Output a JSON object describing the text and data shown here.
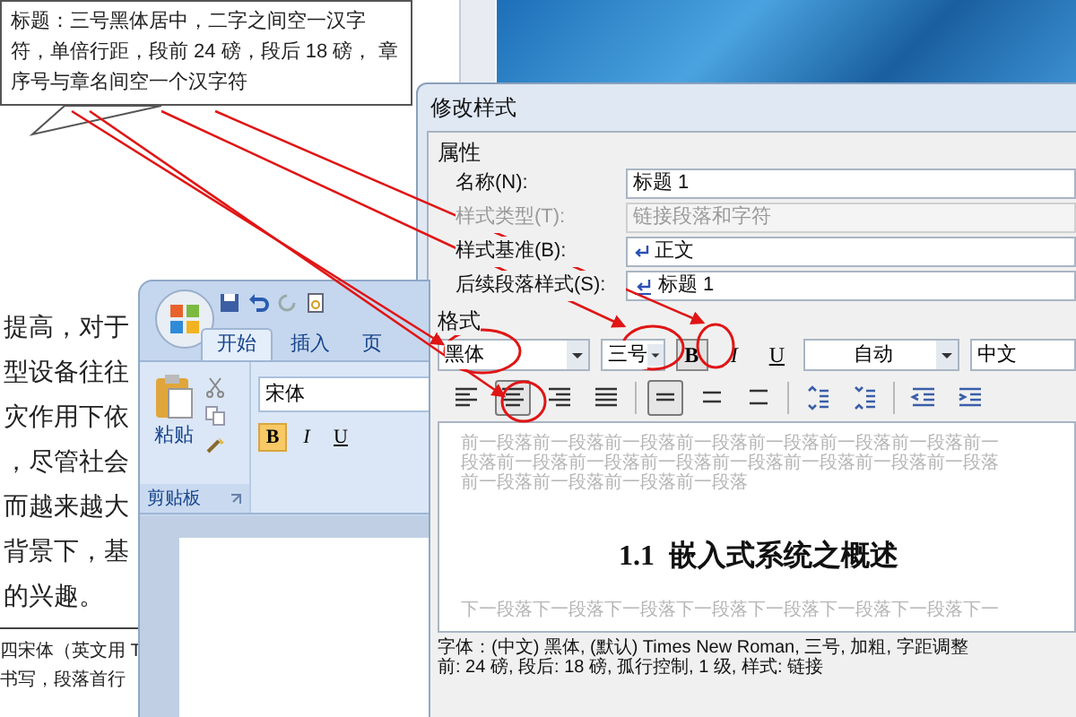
{
  "callout": {
    "text": "标题：三号黑体居中，二字之间空一汉字符，单倍行距，段前 24 磅，段后 18 磅， 章序号与章名间空一个汉字符"
  },
  "document": {
    "lines": [
      "提高，对于",
      "型设备往往",
      "灾作用下依",
      "，尽管社会",
      "而越来越大",
      "背景下，基",
      "的兴趣。"
    ],
    "note_lines": [
      "四宋体（英文用 T",
      "书写，段落首行"
    ]
  },
  "dialog": {
    "title": "修改样式",
    "properties_label": "属性",
    "fields": [
      {
        "label": "名称(N):",
        "value": "标题 1",
        "disabled": false,
        "kind": "text"
      },
      {
        "label": "样式类型(T):",
        "value": "链接段落和字符",
        "disabled": true,
        "kind": "select"
      },
      {
        "label": "样式基准(B):",
        "value": "正文",
        "disabled": false,
        "kind": "paragraph"
      },
      {
        "label": "后续段落样式(S):",
        "value": "标题 1",
        "disabled": false,
        "kind": "linked"
      }
    ],
    "format_label": "格式",
    "font": "黑体",
    "size": "三号",
    "style_buttons": [
      {
        "label": "B",
        "selected": true
      },
      {
        "label": "I",
        "selected": false
      },
      {
        "label": "U",
        "selected": false
      }
    ],
    "font_color_setting": "自动",
    "script": "中文",
    "paragraph_buttons": [
      {
        "kind": "align-left",
        "selected": false
      },
      {
        "kind": "align-center",
        "selected": true
      },
      {
        "kind": "align-right",
        "selected": false
      },
      {
        "kind": "justify",
        "selected": false
      },
      {
        "kind": "single-spacing",
        "selected": true
      },
      {
        "kind": "spacing-1-5",
        "selected": false
      },
      {
        "kind": "double-spacing",
        "selected": false
      },
      {
        "kind": "space-before-up",
        "selected": false
      },
      {
        "kind": "space-before-down",
        "selected": false
      },
      {
        "kind": "indent-decrease",
        "selected": false
      },
      {
        "kind": "indent-increase",
        "selected": false
      }
    ],
    "preview": {
      "before": [
        "前一段落前一段落前一段落前一段落前一段落前一段落前一段落前一",
        "段落前一段落前一段落前一段落前一段落前一段落前一段落前一段落",
        "前一段落前一段落前一段落前一段落"
      ],
      "heading": "1.1  嵌入式系统之概述",
      "after": "下一段落下一段落下一段落下一段落下一段落下一段落下一段落下一"
    },
    "description": [
      "字体：(中文) 黑体, (默认) Times New Roman, 三号, 加粗, 字距调整",
      "前: 24 磅, 段后: 18 磅, 孤行控制, 1 级, 样式: 链接"
    ]
  },
  "word": {
    "tabs": [
      {
        "label": "开始",
        "selected": true
      },
      {
        "label": "插入",
        "selected": false
      },
      {
        "label": "页",
        "selected": false
      }
    ],
    "paste_label": "粘贴",
    "clipboard_label": "剪贴板",
    "font": "宋体",
    "format_buttons": [
      {
        "label": "B",
        "selected": true
      },
      {
        "label": "I",
        "selected": false
      },
      {
        "label": "U",
        "selected": false
      }
    ]
  }
}
